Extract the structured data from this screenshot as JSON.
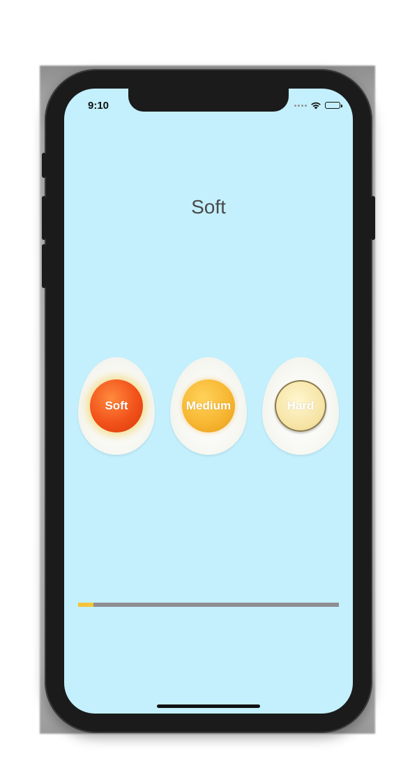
{
  "status_bar": {
    "time": "9:10"
  },
  "main": {
    "title": "Soft",
    "eggs": [
      {
        "label": "Soft"
      },
      {
        "label": "Medium"
      },
      {
        "label": "Hard"
      }
    ],
    "progress": {
      "value": 0.06
    }
  },
  "colors": {
    "background": "#c3f0fc",
    "progress_fill": "#f6c43a",
    "progress_track": "#8e8e93"
  }
}
